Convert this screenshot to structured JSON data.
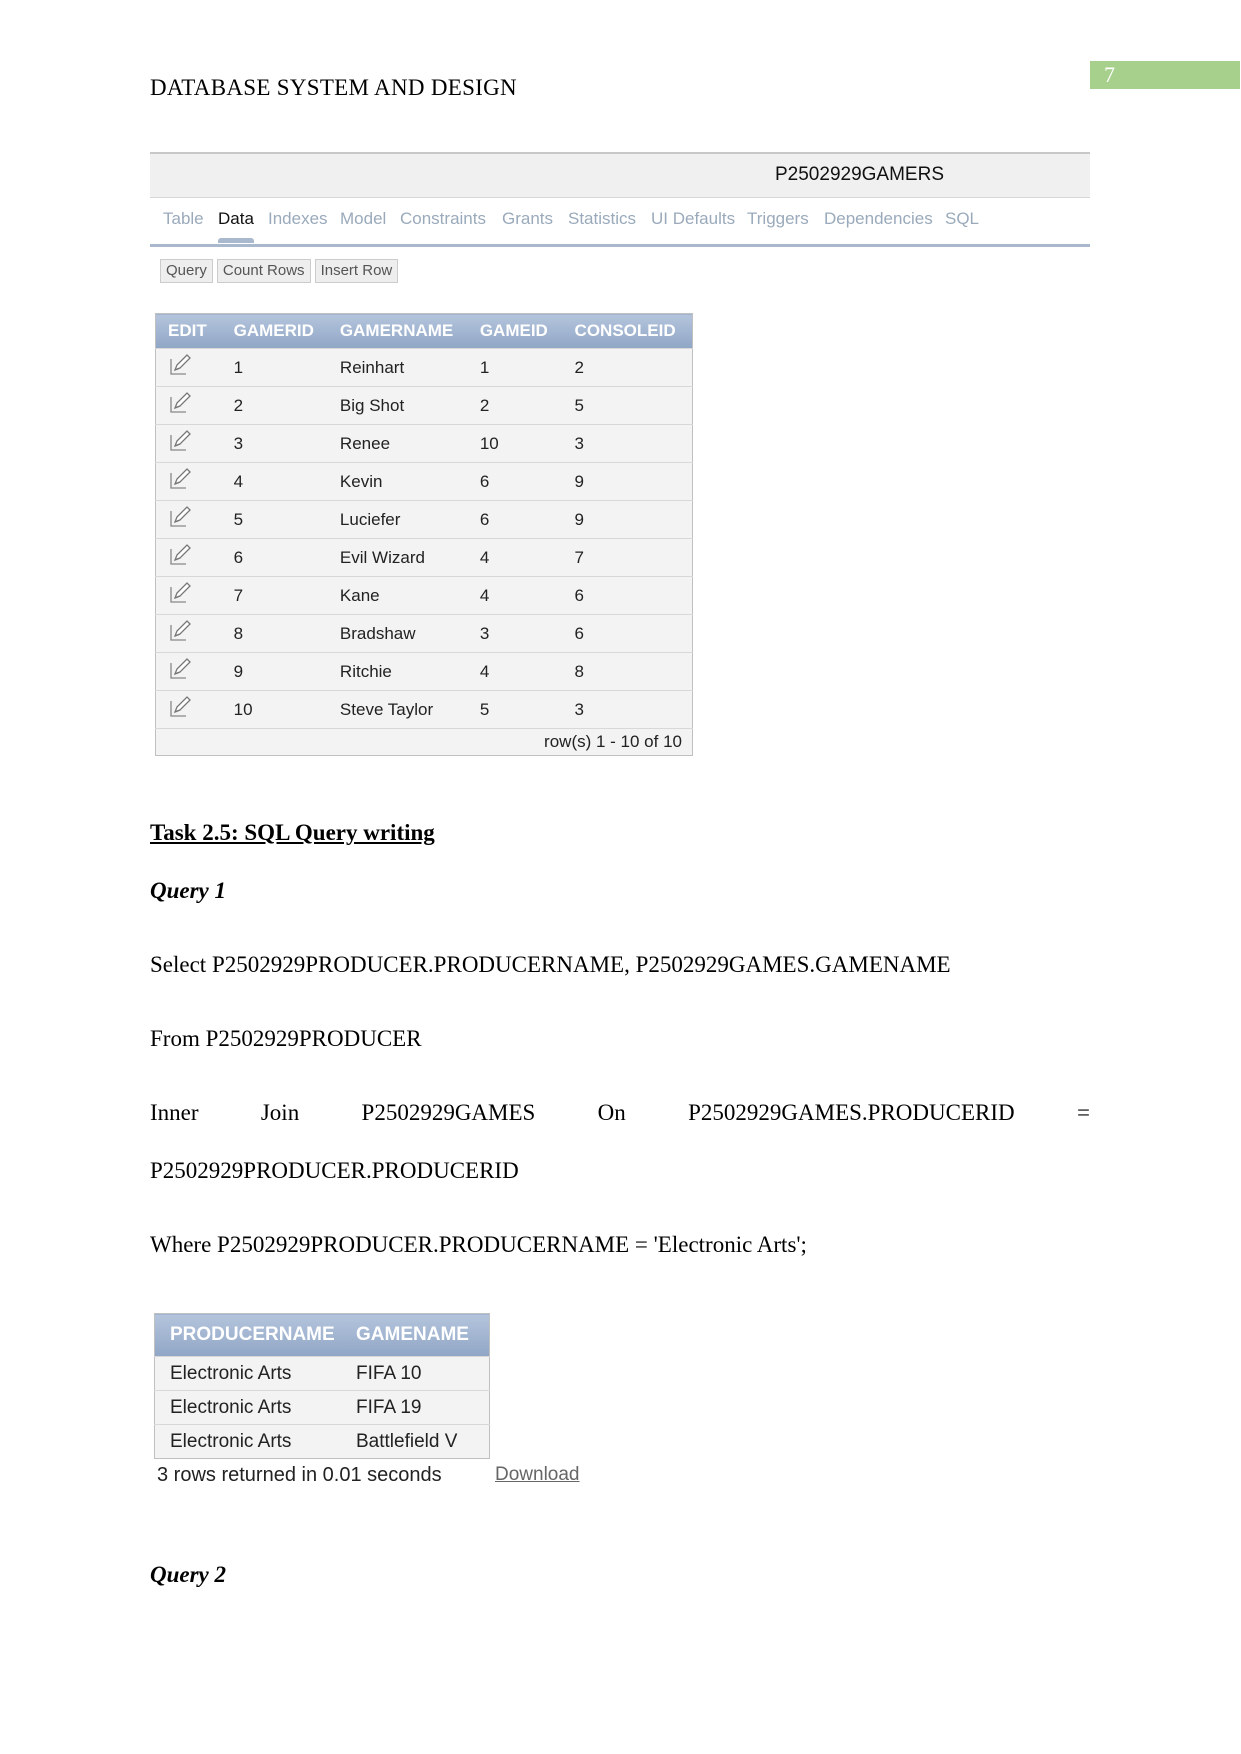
{
  "header": {
    "title": "DATABASE SYSTEM AND DESIGN",
    "page_number": "7",
    "page_number_color": "#a8d08d"
  },
  "screenshot1": {
    "object_title": "P2502929GAMERS",
    "tabs": [
      {
        "label": "Table"
      },
      {
        "label": "Data",
        "active": true
      },
      {
        "label": "Indexes"
      },
      {
        "label": "Model"
      },
      {
        "label": "Constraints"
      },
      {
        "label": "Grants"
      },
      {
        "label": "Statistics"
      },
      {
        "label": "UI Defaults"
      },
      {
        "label": "Triggers"
      },
      {
        "label": "Dependencies"
      },
      {
        "label": "SQL"
      }
    ],
    "buttons": [
      "Query",
      "Count Rows",
      "Insert Row"
    ],
    "columns": [
      "EDIT",
      "GAMERID",
      "GAMERNAME",
      "GAMEID",
      "CONSOLEID"
    ],
    "rows": [
      [
        "1",
        "Reinhart",
        "1",
        "2"
      ],
      [
        "2",
        "Big Shot",
        "2",
        "5"
      ],
      [
        "3",
        "Renee",
        "10",
        "3"
      ],
      [
        "4",
        "Kevin",
        "6",
        "9"
      ],
      [
        "5",
        "Luciefer",
        "6",
        "9"
      ],
      [
        "6",
        "Evil Wizard",
        "4",
        "7"
      ],
      [
        "7",
        "Kane",
        "4",
        "6"
      ],
      [
        "8",
        "Bradshaw",
        "3",
        "6"
      ],
      [
        "9",
        "Ritchie",
        "4",
        "8"
      ],
      [
        "10",
        "Steve Taylor",
        "5",
        "3"
      ]
    ],
    "footer": "row(s) 1 - 10 of 10",
    "edit_icon": "pencil-edit-icon"
  },
  "task": {
    "heading": "Task 2.5: SQL Query writing ",
    "query1_label": "Query 1",
    "sql": {
      "select": "Select P2502929PRODUCER.PRODUCERNAME, P2502929GAMES.GAMENAME",
      "from": "From P2502929PRODUCER",
      "join_words": [
        "Inner",
        "Join",
        "P2502929GAMES",
        "On",
        "P2502929GAMES.PRODUCERID",
        "="
      ],
      "join_cont": "P2502929PRODUCER.PRODUCERID",
      "where": "Where P2502929PRODUCER.PRODUCERNAME = 'Electronic Arts';"
    },
    "query2_label": "Query 2"
  },
  "result1": {
    "columns": [
      "PRODUCERNAME",
      "GAMENAME"
    ],
    "rows": [
      [
        "Electronic Arts",
        "FIFA 10"
      ],
      [
        "Electronic Arts",
        "FIFA 19"
      ],
      [
        "Electronic Arts",
        "Battlefield V"
      ]
    ],
    "status": "3 rows returned in 0.01 seconds",
    "download": "Download"
  }
}
